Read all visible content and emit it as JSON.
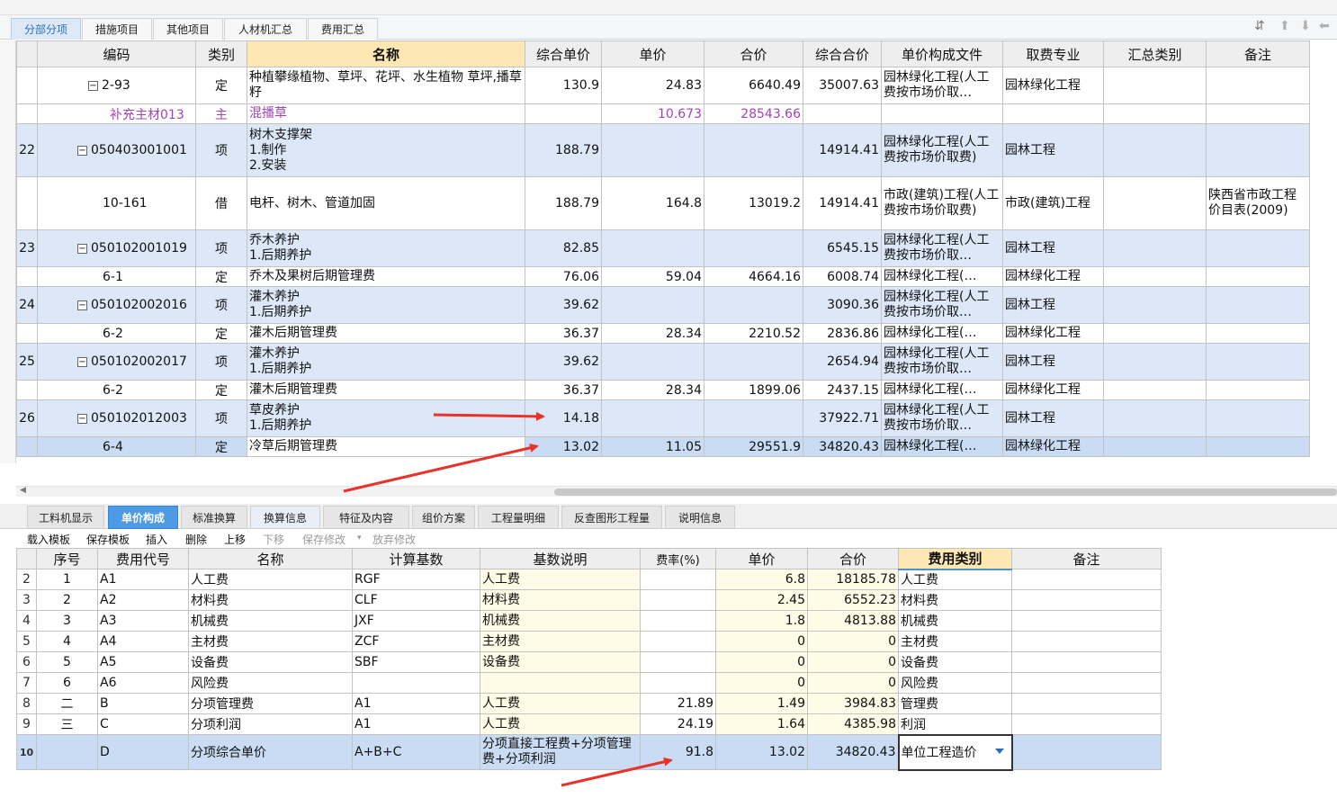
{
  "top_tabs": [
    "分部分项",
    "措施项目",
    "其他项目",
    "人材机汇总",
    "费用汇总"
  ],
  "upper_headers": [
    "编码",
    "类别",
    "名称",
    "综合单价",
    "单价",
    "合价",
    "综合合价",
    "单价构成文件",
    "取费专业",
    "汇总类别",
    "备注"
  ],
  "upper_rows": [
    {
      "no": "",
      "code": "2-93",
      "cat": "定",
      "name": "种植攀缘植物、草坪、花坪、水生植物 草坪,播草籽",
      "unit_total": "130.9",
      "unit": "24.83",
      "total": "6640.49",
      "comp_total": "35007.63",
      "file": "园林绿化工程(人工费按市场价取…",
      "spec": "园林绿化工程",
      "sum": "",
      "remark": ""
    },
    {
      "no": "",
      "code": "补充主材013",
      "cat": "主",
      "name": "混播草",
      "unit_total": "",
      "unit": "10.673",
      "total": "28543.66",
      "comp_total": "",
      "file": "",
      "spec": "",
      "sum": "",
      "remark": ""
    },
    {
      "no": "22",
      "code": "050403001001",
      "cat": "项",
      "name": "树木支撑架\n1.制作\n2.安装",
      "unit_total": "188.79",
      "unit": "",
      "total": "",
      "comp_total": "14914.41",
      "file": "园林绿化工程(人工费按市场价取费)",
      "spec": "园林工程",
      "sum": "",
      "remark": ""
    },
    {
      "no": "",
      "code": "10-161",
      "cat": "借",
      "name": "电杆、树木、管道加固",
      "unit_total": "188.79",
      "unit": "164.8",
      "total": "13019.2",
      "comp_total": "14914.41",
      "file": "市政(建筑)工程(人工费按市场价取费)",
      "spec": "市政(建筑)工程",
      "sum": "",
      "remark": "陕西省市政工程价目表(2009)"
    },
    {
      "no": "23",
      "code": "050102001019",
      "cat": "项",
      "name": "乔木养护\n1.后期养护",
      "unit_total": "82.85",
      "unit": "",
      "total": "",
      "comp_total": "6545.15",
      "file": "园林绿化工程(人工费按市场价取…",
      "spec": "园林工程",
      "sum": "",
      "remark": ""
    },
    {
      "no": "",
      "code": "6-1",
      "cat": "定",
      "name": "乔木及果树后期管理费",
      "unit_total": "76.06",
      "unit": "59.04",
      "total": "4664.16",
      "comp_total": "6008.74",
      "file": "园林绿化工程(…",
      "spec": "园林绿化工程",
      "sum": "",
      "remark": ""
    },
    {
      "no": "24",
      "code": "050102002016",
      "cat": "项",
      "name": "灌木养护\n1.后期养护",
      "unit_total": "39.62",
      "unit": "",
      "total": "",
      "comp_total": "3090.36",
      "file": "园林绿化工程(人工费按市场价取…",
      "spec": "园林工程",
      "sum": "",
      "remark": ""
    },
    {
      "no": "",
      "code": "6-2",
      "cat": "定",
      "name": "灌木后期管理费",
      "unit_total": "36.37",
      "unit": "28.34",
      "total": "2210.52",
      "comp_total": "2836.86",
      "file": "园林绿化工程(…",
      "spec": "园林绿化工程",
      "sum": "",
      "remark": ""
    },
    {
      "no": "25",
      "code": "050102002017",
      "cat": "项",
      "name": "灌木养护\n1.后期养护",
      "unit_total": "39.62",
      "unit": "",
      "total": "",
      "comp_total": "2654.94",
      "file": "园林绿化工程(人工费按市场价取…",
      "spec": "园林工程",
      "sum": "",
      "remark": ""
    },
    {
      "no": "",
      "code": "6-2",
      "cat": "定",
      "name": "灌木后期管理费",
      "unit_total": "36.37",
      "unit": "28.34",
      "total": "1899.06",
      "comp_total": "2437.15",
      "file": "园林绿化工程(…",
      "spec": "园林绿化工程",
      "sum": "",
      "remark": ""
    },
    {
      "no": "26",
      "code": "050102012003",
      "cat": "项",
      "name": "草皮养护\n1.后期养护",
      "unit_total": "14.18",
      "unit": "",
      "total": "",
      "comp_total": "37922.71",
      "file": "园林绿化工程(人工费按市场价取…",
      "spec": "园林工程",
      "sum": "",
      "remark": ""
    },
    {
      "no": "",
      "code": "6-4",
      "cat": "定",
      "name": "冷草后期管理费",
      "unit_total": "13.02",
      "unit": "11.05",
      "total": "29551.9",
      "comp_total": "34820.43",
      "file": "园林绿化工程(…",
      "spec": "园林绿化工程",
      "sum": "",
      "remark": ""
    }
  ],
  "lower_tabs": [
    "工料机显示",
    "单价构成",
    "标准换算",
    "换算信息",
    "特征及内容",
    "组价方案",
    "工程量明细",
    "反查图形工程量",
    "说明信息"
  ],
  "toolbar": [
    "载入模板",
    "保存模板",
    "插入",
    "删除",
    "上移",
    "下移",
    "保存修改",
    "放弃修改"
  ],
  "lower_headers": [
    "序号",
    "费用代号",
    "名称",
    "计算基数",
    "基数说明",
    "费率(%)",
    "单价",
    "合价",
    "费用类别",
    "备注"
  ],
  "lower_rows": [
    {
      "n": "2",
      "seq": "1",
      "code": "A1",
      "name": "人工费",
      "base": "RGF",
      "desc": "人工费",
      "rate": "",
      "unit": "6.8",
      "total": "18185.78",
      "type": "人工费",
      "remark": ""
    },
    {
      "n": "3",
      "seq": "2",
      "code": "A2",
      "name": "材料费",
      "base": "CLF",
      "desc": "材料费",
      "rate": "",
      "unit": "2.45",
      "total": "6552.23",
      "type": "材料费",
      "remark": ""
    },
    {
      "n": "4",
      "seq": "3",
      "code": "A3",
      "name": "机械费",
      "base": "JXF",
      "desc": "机械费",
      "rate": "",
      "unit": "1.8",
      "total": "4813.88",
      "type": "机械费",
      "remark": ""
    },
    {
      "n": "5",
      "seq": "4",
      "code": "A4",
      "name": "主材费",
      "base": "ZCF",
      "desc": "主材费",
      "rate": "",
      "unit": "0",
      "total": "0",
      "type": "主材费",
      "remark": ""
    },
    {
      "n": "6",
      "seq": "5",
      "code": "A5",
      "name": "设备费",
      "base": "SBF",
      "desc": "设备费",
      "rate": "",
      "unit": "0",
      "total": "0",
      "type": "设备费",
      "remark": ""
    },
    {
      "n": "7",
      "seq": "6",
      "code": "A6",
      "name": "风险费",
      "base": "",
      "desc": "",
      "rate": "",
      "unit": "0",
      "total": "0",
      "type": "风险费",
      "remark": ""
    },
    {
      "n": "8",
      "seq": "二",
      "code": "B",
      "name": "分项管理费",
      "base": "A1",
      "desc": "人工费",
      "rate": "21.89",
      "unit": "1.49",
      "total": "3984.83",
      "type": "管理费",
      "remark": ""
    },
    {
      "n": "9",
      "seq": "三",
      "code": "C",
      "name": "分项利润",
      "base": "A1",
      "desc": "人工费",
      "rate": "24.19",
      "unit": "1.64",
      "total": "4385.98",
      "type": "利润",
      "remark": ""
    },
    {
      "n": "10",
      "seq": "",
      "code": "D",
      "name": "分项综合单价",
      "base": "A+B+C",
      "desc": "分项直接工程费+分项管理费+分项利润",
      "rate": "91.8",
      "unit": "13.02",
      "total": "34820.43",
      "type": "单位工程造价",
      "remark": ""
    }
  ]
}
